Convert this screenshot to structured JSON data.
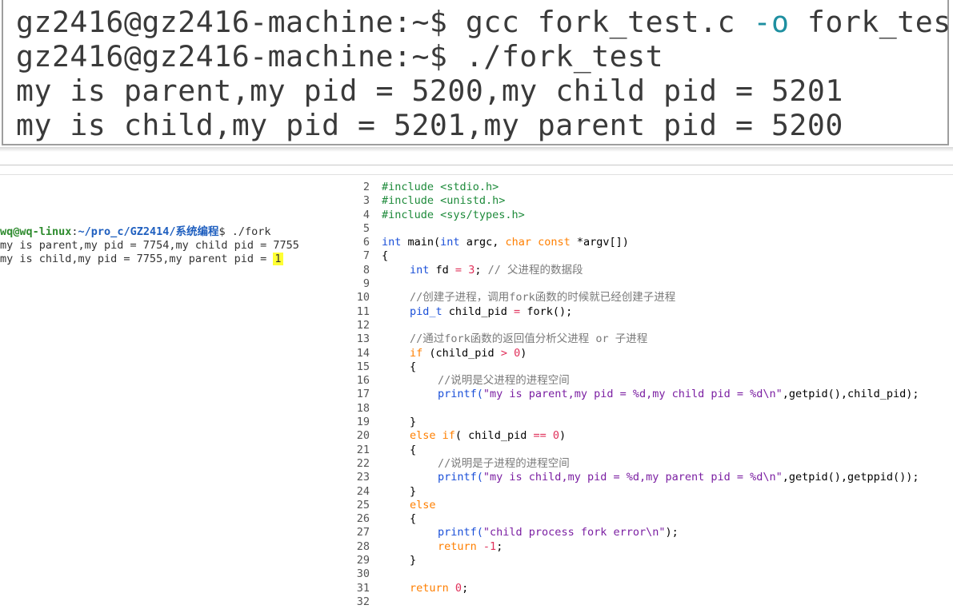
{
  "big_terminal": {
    "line1_prompt": "gz2416@gz2416-machine:~$ gcc fork_test.c ",
    "line1_opt": "-o",
    "line1_rest": " fork_test",
    "line2": "gz2416@gz2416-machine:~$ ./fork_test",
    "line3": "my is parent,my pid = 5200,my child pid = 5201",
    "line4": "my is child,my pid = 5201,my parent pid = 5200"
  },
  "small_terminal": {
    "prompt_user": "wq@wq-linux",
    "prompt_sep": ":",
    "prompt_path": "~/pro_c/GZ2414/系统编程",
    "prompt_cmd": "$ ./fork",
    "out1": "my is parent,my pid = 7754,my child pid = 7755",
    "out2_pre": "my is child,my pid = 7755,my parent pid = ",
    "out2_hl": "1"
  },
  "editor": {
    "line_numbers": [
      "2",
      "3",
      "4",
      "5",
      "6",
      "7",
      "8",
      "9",
      "10",
      "11",
      "12",
      "13",
      "14",
      "15",
      "16",
      "17",
      "18",
      "19",
      "20",
      "21",
      "22",
      "23",
      "24",
      "25",
      "26",
      "27",
      "28",
      "29",
      "30",
      "31",
      "32"
    ],
    "l2": "#include <stdio.h>",
    "l3": "#include <unistd.h>",
    "l4": "#include <sys/types.h>",
    "l6_int": "int",
    "l6_main": " main(",
    "l6_int2": "int",
    "l6_mid": " argc, ",
    "l6_char": "char",
    "l6_sp": " ",
    "l6_const": "const",
    "l6_star": " *",
    "l6_end": "argv[])",
    "l7": "{",
    "l8_int": "int",
    "l8_fd": " fd ",
    "l8_eq": "=",
    "l8_sp": " ",
    "l8_num": "3",
    "l8_semi": "; ",
    "l8_cm": "// 父进程的数据段",
    "l10": "//创建子进程，调用fork函数的时候就已经创建子进程",
    "l11_ty": "pid_t",
    "l11_rest": " child_pid ",
    "l11_eq": "=",
    "l11_call": " fork();",
    "l13": "//通过fork函数的返回值分析父进程 or 子进程",
    "l14_if": "if",
    "l14_a": " (child_pid ",
    "l14_gt": ">",
    "l14_sp": " ",
    "l14_zero": "0",
    "l14_b": ")",
    "l15": "{",
    "l16": "//说明是父进程的进程空间",
    "l17_fn": "printf(",
    "l17_str": "\"my is parent,my pid = %d,my child pid = %d\\n\"",
    "l17_rest": ",getpid(),child_pid);",
    "l19": "}",
    "l20_else": "else",
    "l20_sp": " ",
    "l20_if": "if",
    "l20_a": "( child_pid ",
    "l20_eq": "==",
    "l20_sp2": " ",
    "l20_zero": "0",
    "l20_b": ")",
    "l21": "{",
    "l22": "//说明是子进程的进程空间",
    "l23_fn": "printf(",
    "l23_str": "\"my is child,my pid = %d,my parent pid = %d\\n\"",
    "l23_rest": ",getpid(),getppid());",
    "l24": "}",
    "l25": "else",
    "l26": "{",
    "l27_fn": "printf(",
    "l27_str": "\"child process fork error\\n\"",
    "l27_rest": ");",
    "l28_ret": "return",
    "l28_sp": " ",
    "l28_num": "-1",
    "l28_semi": ";",
    "l29": "}",
    "l31_ret": "return",
    "l31_sp": " ",
    "l31_num": "0",
    "l31_semi": ";"
  }
}
